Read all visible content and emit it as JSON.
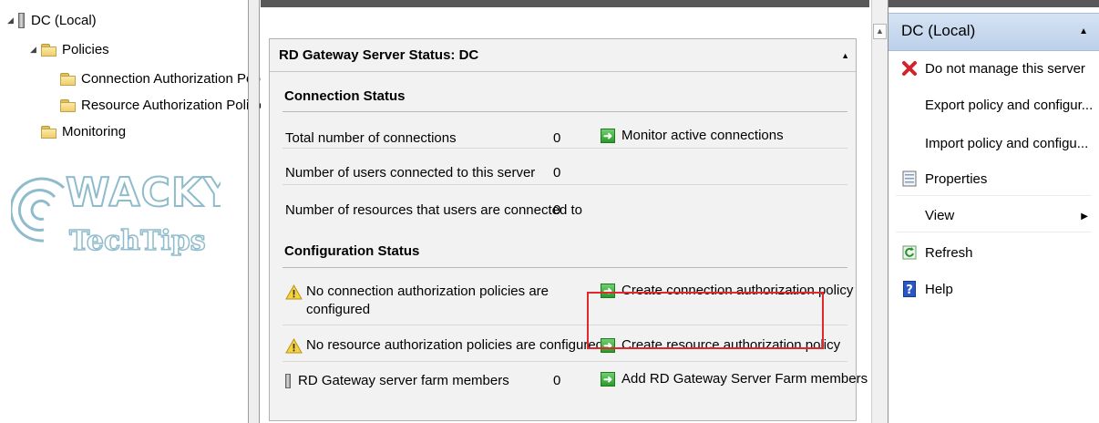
{
  "tree": {
    "root_label": "DC (Local)",
    "policies_label": "Policies",
    "cap_label": "Connection Authorization Policies",
    "rap_label": "Resource Authorization Policies",
    "monitoring_label": "Monitoring"
  },
  "watermark": {
    "line1": "WACKY",
    "line2": "TechTips"
  },
  "panel": {
    "title": "RD Gateway Server Status: DC",
    "connection_status_title": "Connection Status",
    "connection_rows": [
      {
        "label": "Total number of connections",
        "value": "0",
        "action": "Monitor active connections"
      },
      {
        "label": "Number of users connected to this server",
        "value": "0"
      },
      {
        "label": "Number of resources that users are connected to",
        "value": "0"
      }
    ],
    "configuration_status_title": "Configuration Status",
    "config_rows": [
      {
        "label_line1": "No connection authorization policies are",
        "label_line2": "configured",
        "action": "Create connection authorization policy"
      },
      {
        "label": "No resource authorization policies are configured",
        "action": "Create resource authorization policy"
      },
      {
        "label": "RD Gateway server farm members",
        "value": "0",
        "action": "Add RD Gateway Server Farm members"
      }
    ]
  },
  "actions": {
    "title": "DC (Local)",
    "items": [
      {
        "label": "Do not manage this server",
        "icon": "red-x-icon"
      },
      {
        "label": "Export policy and configur...",
        "icon": ""
      },
      {
        "label": "Import policy and configu...",
        "icon": ""
      },
      {
        "label": "Properties",
        "icon": "properties-icon"
      },
      {
        "label": "View",
        "icon": ""
      },
      {
        "label": "Refresh",
        "icon": "refresh-icon"
      },
      {
        "label": "Help",
        "icon": "help-icon"
      }
    ]
  },
  "colors": {
    "highlight": "#e0282e",
    "actions_header": "#c6d8ee",
    "go_icon": "#2a9c2a"
  }
}
